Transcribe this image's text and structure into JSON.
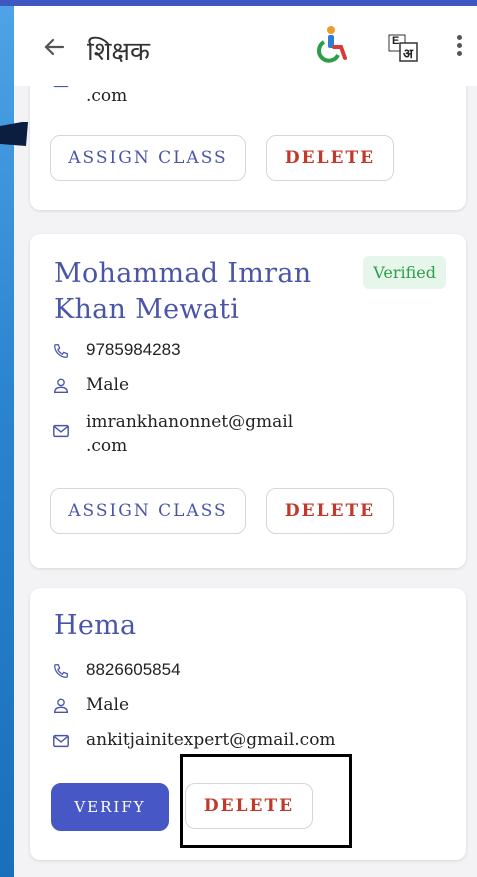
{
  "app_bar": {
    "title": "शिक्षक",
    "back_icon": "arrow-left-icon",
    "accessibility_icon": "accessibility-icon",
    "language_icon": "translate-icon",
    "menu_icon": "more-vertical-icon",
    "language_glyph_en": "E",
    "language_glyph_hi": "अ"
  },
  "colors": {
    "primary": "#4758c6",
    "name_text": "#4a55a8",
    "delete_text": "#c0392b",
    "verified_bg": "#e6f6ea",
    "verified_text": "#2e9d4a"
  },
  "teachers": [
    {
      "email_tail": ".com",
      "buttons": {
        "assign": "ASSIGN CLASS",
        "delete": "DELETE"
      }
    },
    {
      "name": "Mohammad Imran Khan Mewati",
      "status": "Verified",
      "phone": "9785984283",
      "gender": "Male",
      "email_line1": "imrankhanonnet@gmail",
      "email_line2": ".com",
      "buttons": {
        "assign": "ASSIGN CLASS",
        "delete": "DELETE"
      }
    },
    {
      "name": "Hema",
      "phone": "8826605854",
      "gender": "Male",
      "email": "ankitjainitexpert@gmail.com",
      "buttons": {
        "verify": "VERIFY",
        "delete": "DELETE"
      }
    }
  ]
}
